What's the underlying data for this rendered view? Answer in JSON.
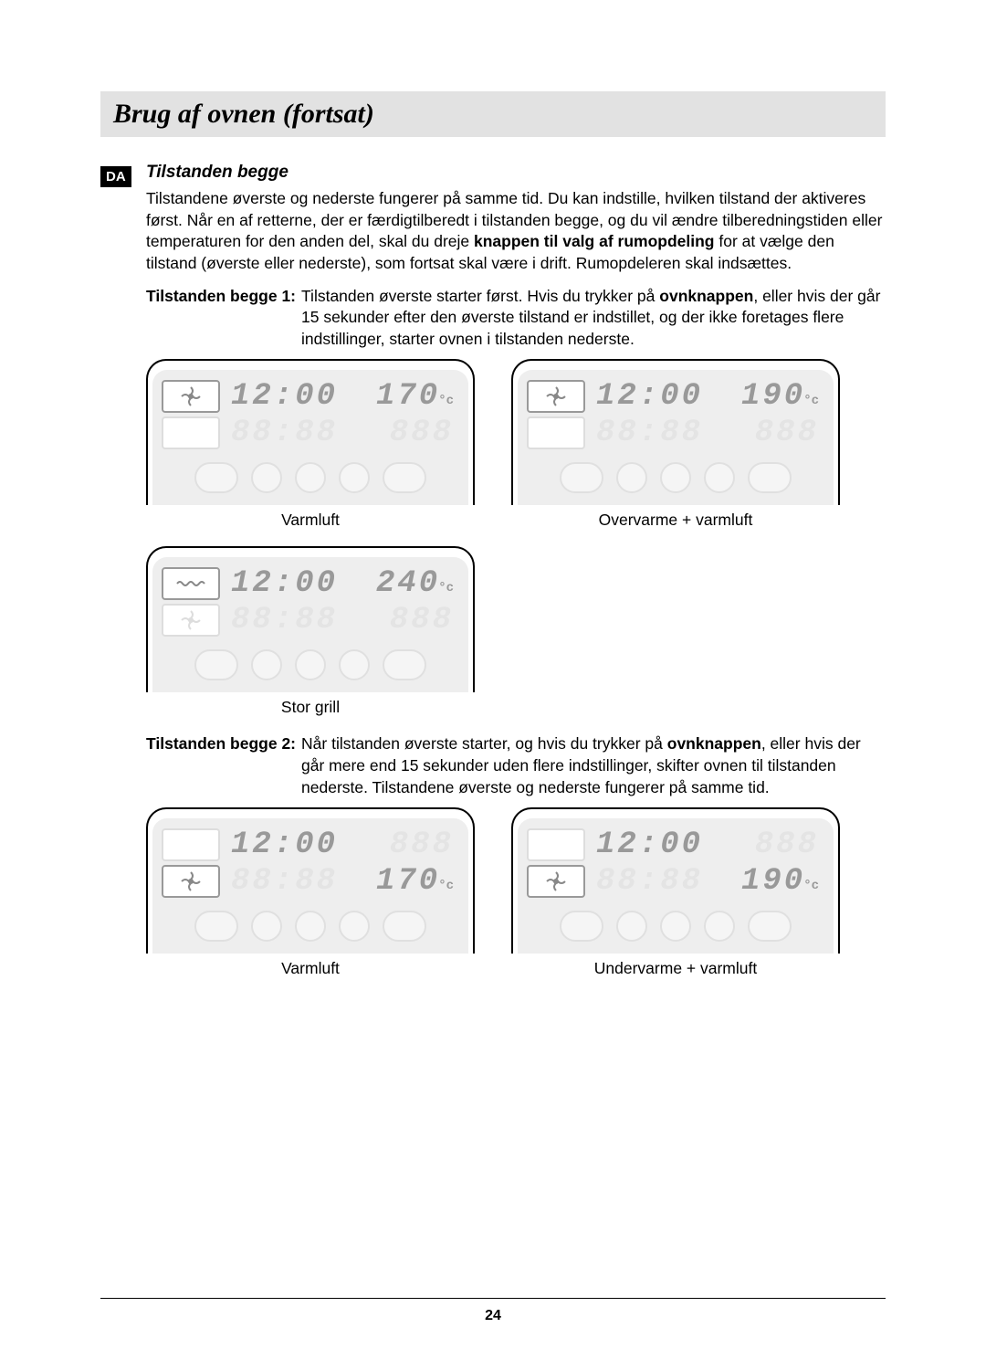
{
  "header": {
    "title": "Brug af ovnen (fortsat)"
  },
  "lang_tag": "DA",
  "section_title": "Tilstanden begge",
  "intro_html": "Tilstandene øverste og nederste fungerer på samme tid. Du kan indstille, hvilken tilstand der aktiveres først. Når en af retterne, der er færdigtilberedt i tilstanden begge, og du vil ændre tilberedningstiden eller temperaturen for den anden del, skal du dreje <b>knappen til valg af rumopdeling</b> for at vælge den tilstand (øverste eller nederste), som fortsat skal være i drift. Rumopdeleren skal indsættes.",
  "mode1": {
    "label": "Tilstanden begge 1:",
    "text_html": "Tilstanden øverste starter først. Hvis du trykker på <b>ovnknappen</b>, eller hvis der går 15 sekunder efter den øverste tilstand er indstillet, og der ikke foretages flere indstillinger, starter ovnen i tilstanden nederste."
  },
  "mode2": {
    "label": "Tilstanden begge 2:",
    "text_html": "Når tilstanden øverste starter, og hvis du trykker på <b>ovnknappen</b>, eller hvis der går mere end 15 sekunder uden flere indstillinger, skifter ovnen til tilstanden nederste. Tilstandene øverste og nederste fungerer på samme tid."
  },
  "panels": {
    "row1": [
      {
        "caption": "Varmluft",
        "icon_top": "fan",
        "icon_top_active": true,
        "icon_bottom": null,
        "top_time": "12:00",
        "top_temp": "170",
        "top_unit": "°c",
        "bottom_time": "88:88",
        "bottom_temp": "888",
        "bottom_active": false
      },
      {
        "caption": "Overvarme + varmluft",
        "icon_top": "fan",
        "icon_top_active": true,
        "icon_bottom": null,
        "top_time": "12:00",
        "top_temp": "190",
        "top_unit": "°c",
        "bottom_time": "88:88",
        "bottom_temp": "888",
        "bottom_active": false
      }
    ],
    "row2": [
      {
        "caption": "Stor grill",
        "icon_top": "grill",
        "icon_top_active": true,
        "icon_bottom": "fan",
        "icon_bottom_active": false,
        "top_time": "12:00",
        "top_temp": "240",
        "top_unit": "°c",
        "bottom_time": "88:88",
        "bottom_temp": "888",
        "bottom_active": false
      }
    ],
    "row3": [
      {
        "caption": "Varmluft",
        "icon_top": null,
        "icon_bottom": "fan",
        "icon_bottom_active": true,
        "top_time": "12:00",
        "top_temp": "888",
        "top_active_temp": false,
        "bottom_time": "88:88",
        "bottom_temp": "170",
        "bottom_unit": "°c",
        "bottom_active": true
      },
      {
        "caption": "Undervarme + varmluft",
        "icon_top": null,
        "icon_bottom": "fan",
        "icon_bottom_active": true,
        "top_time": "12:00",
        "top_temp": "888",
        "top_active_temp": false,
        "bottom_time": "88:88",
        "bottom_temp": "190",
        "bottom_unit": "°c",
        "bottom_active": true
      }
    ]
  },
  "page_number": "24"
}
